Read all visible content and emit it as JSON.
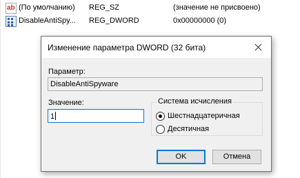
{
  "registry": {
    "rows": [
      {
        "name": "(По умолчанию)",
        "type": "REG_SZ",
        "data": "(значение не присвоено)",
        "icon": "string-value-icon"
      },
      {
        "name": "DisableAntiSpy...",
        "type": "REG_DWORD",
        "data": "0x00000000 (0)",
        "icon": "binary-value-icon"
      }
    ]
  },
  "dialog": {
    "title": "Изменение параметра DWORD (32 бита)",
    "param_label": "Параметр:",
    "param_value": "DisableAntiSpyware",
    "value_label": "Значение:",
    "value_input": "1",
    "base_group_label": "Система исчисления",
    "radio_hex": "Шестнадцатеричная",
    "radio_dec": "Десятичная",
    "selected_base": "hex",
    "ok_label": "OK",
    "cancel_label": "Отмена"
  }
}
